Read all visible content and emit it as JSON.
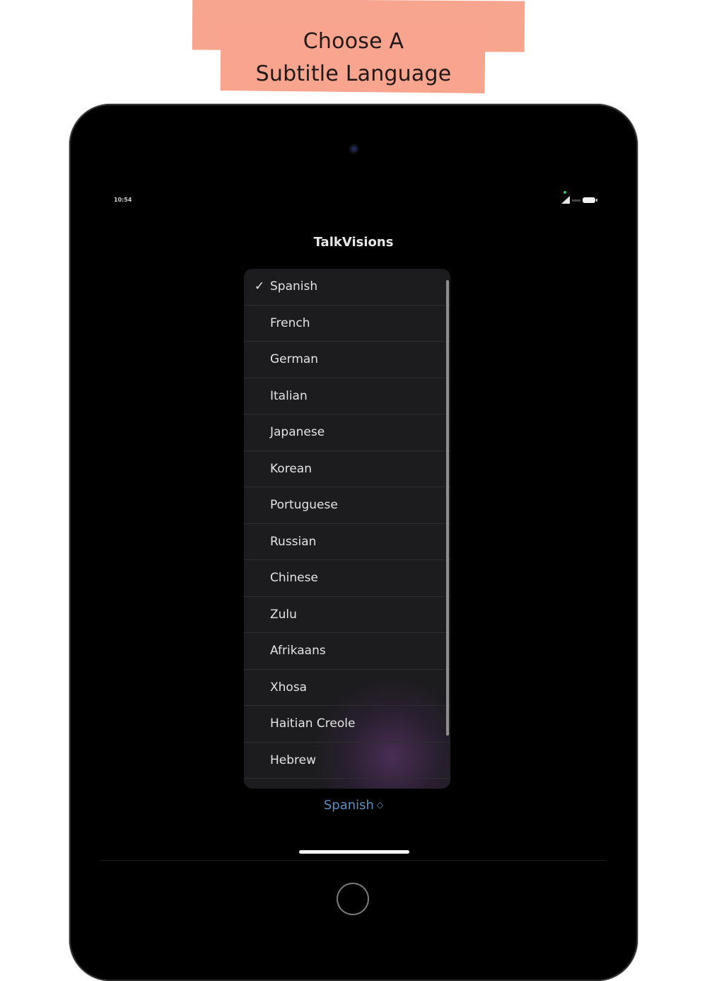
{
  "banner": {
    "line1": "Choose A",
    "line2": "Subtitle Language",
    "color": "#f8a48e"
  },
  "status_bar": {
    "time": "10:54",
    "icons": [
      "signal-icon",
      "battery-icon"
    ]
  },
  "app": {
    "title": "TalkVisions"
  },
  "language_menu": {
    "selected_index": 0,
    "check_glyph": "✓",
    "items": [
      {
        "label": "Spanish",
        "checked": true
      },
      {
        "label": "French",
        "checked": false
      },
      {
        "label": "German",
        "checked": false
      },
      {
        "label": "Italian",
        "checked": false
      },
      {
        "label": "Japanese",
        "checked": false
      },
      {
        "label": "Korean",
        "checked": false
      },
      {
        "label": "Portuguese",
        "checked": false
      },
      {
        "label": "Russian",
        "checked": false
      },
      {
        "label": "Chinese",
        "checked": false
      },
      {
        "label": "Zulu",
        "checked": false
      },
      {
        "label": "Afrikaans",
        "checked": false
      },
      {
        "label": "Xhosa",
        "checked": false
      },
      {
        "label": "Haitian Creole",
        "checked": false
      },
      {
        "label": "Hebrew",
        "checked": false
      }
    ]
  },
  "picker": {
    "value": "Spanish",
    "chevron_glyph": "◇",
    "accent_color": "#5b8fbf"
  }
}
